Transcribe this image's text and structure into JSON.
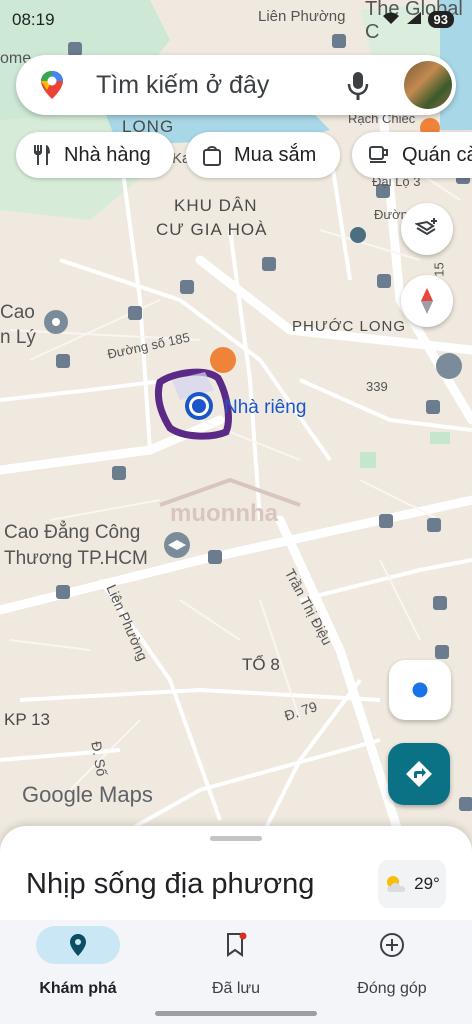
{
  "status": {
    "time": "08:19",
    "battery": "93"
  },
  "search": {
    "placeholder": "Tìm kiếm ở đây"
  },
  "chips": [
    {
      "label": "Nhà hàng",
      "icon": "fork-knife-icon"
    },
    {
      "label": "Mua sắm",
      "icon": "shopping-bag-icon"
    },
    {
      "label": "Quán cà",
      "icon": "coffee-cup-icon"
    }
  ],
  "map": {
    "labels": {
      "lien_phuong_top": "Liên Phường",
      "global_c": "The Global C",
      "long": "LONG",
      "rach_chiec": "Rạch Chiếc",
      "dai_lo_3": "Đại Lộ 3",
      "duong": "Đườn",
      "khu_dan_1": "KHU DÂN",
      "khu_dan_2": "CƯ GIA HOÀ",
      "num_15": "15",
      "cao_ly_1": "Cao",
      "cao_ly_2": "n Lý",
      "phuoc_long": "PHƯỚC LONG",
      "duong_185": "Đường số 185",
      "num_339": "339",
      "nha_rieng": "Nhà riêng",
      "cao_dang_1": "Cao Đẳng Công",
      "cao_dang_2": "Thương TP.HCM",
      "lien_phuong": "Liên Phường",
      "tran_thi_dieu": "Trần Thị Điệu",
      "to_8": "TỔ 8",
      "kp13": "KP 13",
      "d79": "Đ. 79",
      "d_so": "Đ. Số",
      "ome": "ome",
      "ka": "Ka",
      "watermark": "muonnha"
    },
    "google_logo": "Google Maps"
  },
  "sheet": {
    "title": "Nhịp sống địa phương",
    "temperature": "29°"
  },
  "nav": [
    {
      "label": "Khám phá",
      "icon": "location-pin-icon",
      "active": true
    },
    {
      "label": "Đã lưu",
      "icon": "bookmark-icon",
      "active": false
    },
    {
      "label": "Đóng góp",
      "icon": "add-circle-icon",
      "active": false
    }
  ],
  "colors": {
    "accent": "#0b7285",
    "nav_active_bg": "#c9e7f4",
    "map_bg": "#f1ece2",
    "location_blue": "#1a73e8",
    "highlight": "#5b2a86"
  }
}
